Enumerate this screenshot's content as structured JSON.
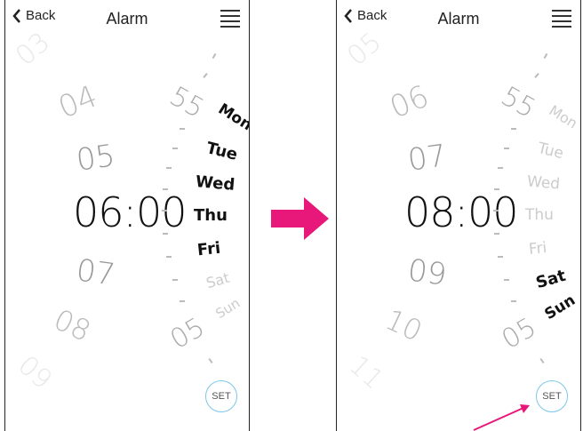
{
  "left": {
    "back_label": "Back",
    "title": "Alarm",
    "hours": [
      "03",
      "04",
      "05",
      "07",
      "08",
      "09"
    ],
    "time": "06:00",
    "minutes": [
      "55",
      "05"
    ],
    "days": [
      {
        "label": "Mon",
        "on": true
      },
      {
        "label": "Tue",
        "on": true
      },
      {
        "label": "Wed",
        "on": true
      },
      {
        "label": "Thu",
        "on": true
      },
      {
        "label": "Fri",
        "on": true
      },
      {
        "label": "Sat",
        "on": false
      },
      {
        "label": "Sun",
        "on": false
      }
    ],
    "set_label": "SET"
  },
  "right": {
    "back_label": "Back",
    "title": "Alarm",
    "hours": [
      "05",
      "06",
      "07",
      "09",
      "10",
      "11"
    ],
    "time": "08:00",
    "minutes": [
      "55",
      "05"
    ],
    "days": [
      {
        "label": "Mon",
        "on": false
      },
      {
        "label": "Tue",
        "on": false
      },
      {
        "label": "Wed",
        "on": false
      },
      {
        "label": "Thu",
        "on": false
      },
      {
        "label": "Fri",
        "on": false
      },
      {
        "label": "Sat",
        "on": true
      },
      {
        "label": "Sun",
        "on": true
      }
    ],
    "set_label": "SET"
  },
  "colors": {
    "arrow": "#e8177a",
    "set_ring": "#7cc6ea"
  }
}
